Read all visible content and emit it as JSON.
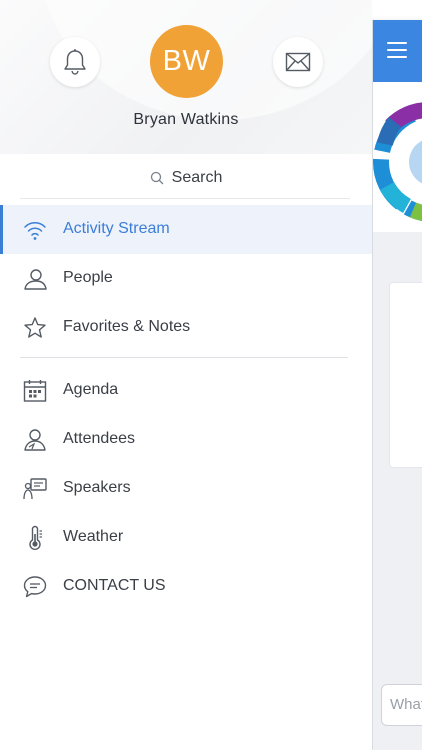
{
  "user": {
    "initials": "BW",
    "name": "Bryan Watkins"
  },
  "header": {
    "bell_icon": "bell-icon",
    "mail_icon": "mail-icon",
    "avatar_color": "#f0a236"
  },
  "search": {
    "label": "Search"
  },
  "menu_primary": [
    {
      "label": "Activity Stream",
      "icon": "wifi-icon",
      "active": true
    },
    {
      "label": "People",
      "icon": "person-icon",
      "active": false
    },
    {
      "label": "Favorites & Notes",
      "icon": "star-icon",
      "active": false
    }
  ],
  "menu_secondary": [
    {
      "label": "Agenda",
      "icon": "calendar-icon"
    },
    {
      "label": "Attendees",
      "icon": "attendees-icon"
    },
    {
      "label": "Speakers",
      "icon": "speakers-icon"
    },
    {
      "label": "Weather",
      "icon": "thermometer-icon"
    },
    {
      "label": "CONTACT US",
      "icon": "chat-icon"
    }
  ],
  "app_panel": {
    "compose_placeholder": "What",
    "bar_color": "#3b86e0"
  },
  "colors": {
    "accent": "#3b7ed8",
    "active_bg": "#eef3fb"
  }
}
